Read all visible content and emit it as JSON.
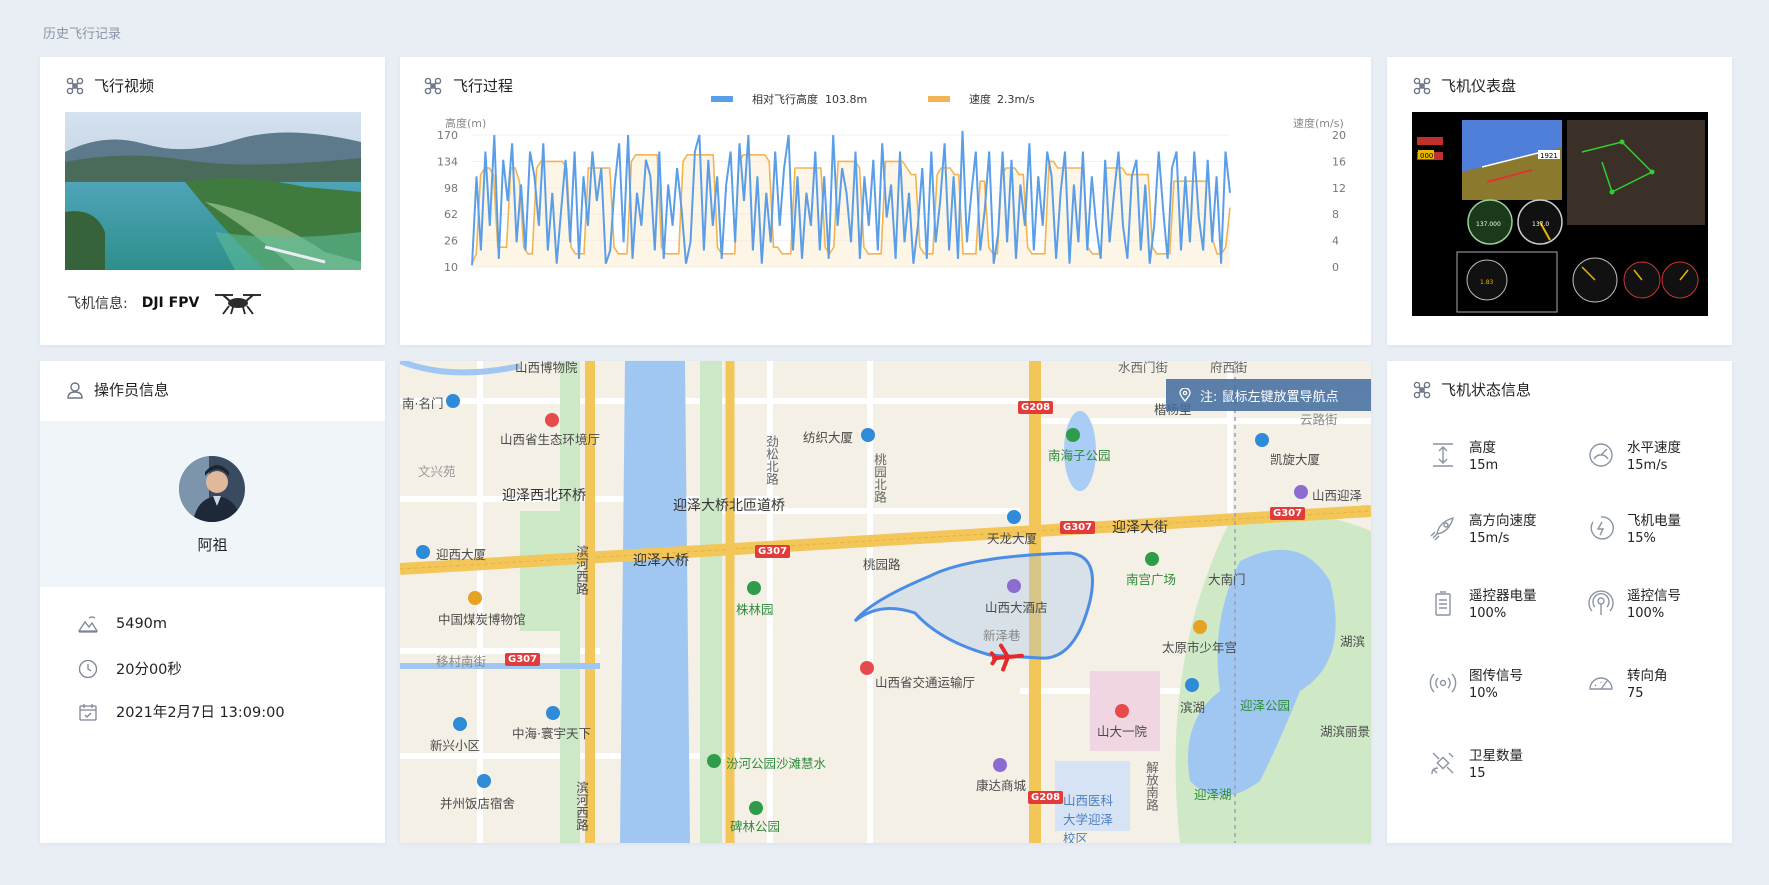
{
  "breadcrumb": "历史飞行记录",
  "video_card": {
    "title": "飞行视频",
    "aircraft_label": "飞机信息:",
    "aircraft_model": "DJI FPV"
  },
  "chart_card": {
    "title": "飞行过程"
  },
  "chart_data": {
    "type": "line",
    "legend_position": "top-center",
    "ylabel_left": "高度(m)",
    "ylabel_right": "速度(m/s)",
    "left_ticks": [
      "170",
      "134",
      "98",
      "62",
      "26",
      "10"
    ],
    "right_ticks": [
      "20",
      "16",
      "12",
      "8",
      "4",
      "0"
    ],
    "ylim_left": [
      10,
      170
    ],
    "ylim_right": [
      0,
      20
    ],
    "grid": true,
    "series": [
      {
        "name": "相对飞行高度",
        "legend_value": "103.8m",
        "color": "#5b9ee8",
        "axis": "left",
        "values": [
          12,
          120,
          30,
          150,
          60,
          170,
          20,
          140,
          90,
          160,
          40,
          110,
          30,
          150,
          120,
          60,
          160,
          30,
          100,
          14,
          80,
          140,
          40,
          150,
          20,
          120,
          60,
          150,
          90,
          130,
          14,
          30,
          110,
          160,
          40,
          170,
          20,
          100,
          60,
          140,
          120,
          30,
          150,
          20,
          110,
          60,
          130,
          80,
          14,
          40,
          150,
          170,
          30,
          140,
          60,
          120,
          20,
          110,
          150,
          40,
          160,
          90,
          170,
          30,
          120,
          14,
          100,
          40,
          150,
          60,
          130,
          170,
          30,
          120,
          20,
          100,
          60,
          150,
          30,
          120,
          20,
          170,
          60,
          130,
          100,
          40,
          150,
          20,
          120,
          60,
          140,
          30,
          160,
          70,
          110,
          20,
          150,
          40,
          100,
          14,
          60,
          130,
          20,
          150,
          40,
          90,
          160,
          30,
          120,
          20,
          175,
          40,
          100,
          150,
          30,
          80,
          150,
          14,
          50,
          150,
          40,
          140,
          20,
          110,
          60,
          160,
          30,
          120,
          60,
          150,
          120,
          20,
          100,
          150,
          14,
          110,
          40,
          150,
          30,
          120,
          60,
          20,
          140,
          40,
          100,
          150,
          60,
          20,
          120,
          140,
          30,
          110,
          14,
          60,
          150,
          80,
          20,
          130,
          150,
          30,
          120,
          40,
          150,
          70,
          30,
          140,
          40,
          120,
          14,
          150,
          100
        ]
      },
      {
        "name": "速度",
        "legend_value": "2.3m/s",
        "color": "#f2b453",
        "axis": "right",
        "values": [
          0.5,
          2,
          14,
          15,
          15,
          14,
          3,
          3,
          3,
          15,
          15,
          13,
          3,
          2,
          2,
          15,
          16,
          16,
          16,
          16,
          16,
          16,
          15,
          3,
          2,
          2,
          2,
          15,
          15,
          15,
          15,
          15,
          15,
          3,
          2,
          2,
          2,
          16,
          17,
          17,
          17,
          17,
          17,
          17,
          3,
          2,
          2,
          2,
          2,
          16,
          17,
          17,
          17,
          17,
          17,
          17,
          17,
          3,
          2,
          2,
          2,
          2,
          16,
          17,
          17,
          17,
          17,
          17,
          17,
          16,
          3,
          3,
          2,
          2,
          2,
          15,
          15,
          15,
          15,
          15,
          15,
          15,
          3,
          2,
          3,
          16,
          16,
          16,
          16,
          16,
          15,
          3,
          2,
          2,
          2,
          2,
          16,
          16,
          16,
          16,
          16,
          15,
          14,
          14,
          3,
          2,
          2,
          2,
          14,
          15,
          15,
          15,
          14,
          14,
          2,
          2,
          2,
          2,
          13,
          13,
          3,
          2,
          2,
          14,
          15,
          15,
          15,
          14,
          14,
          3,
          2,
          2,
          2,
          2,
          16,
          16,
          15,
          15,
          15,
          15,
          15,
          15,
          15,
          3,
          2,
          2,
          2,
          15,
          15,
          15,
          15,
          15,
          14,
          14,
          14,
          14,
          14,
          14,
          3,
          2,
          2,
          2,
          2,
          13,
          13,
          13,
          13,
          13,
          13,
          13,
          13,
          13,
          4,
          2,
          2,
          3,
          9
        ]
      }
    ]
  },
  "dashboard_card": {
    "title": "飞机仪表盘",
    "hud_values": [
      "000",
      "1921",
      "137.000",
      "137.0",
      "1.83"
    ]
  },
  "operator_card": {
    "title": "操作员信息",
    "name": "阿祖",
    "distance": "5490m",
    "duration": "20分00秒",
    "datetime": "2021年2月7日 13:09:00"
  },
  "map": {
    "note": "注: 鼠标左键放置导航点",
    "labels": [
      "山西博物院",
      "山西省生态环境厅",
      "文兴苑",
      "迎泽西北环桥",
      "迎西大厦",
      "中国煤炭博物馆",
      "移村南街",
      "新兴小区",
      "中海·寰宇天下",
      "并州饭店宿舍",
      "滨河西路",
      "迎泽大桥北匝道桥",
      "迎泽大桥",
      "滨河西路",
      "株林园",
      "汾河公园沙滩慧水",
      "碑林公园",
      "纺织大厦",
      "劲松北路",
      "桃园北路",
      "桃园路",
      "天龙大厦",
      "山西大酒店",
      "新泽巷",
      "山西省交通运输厅",
      "康达商城",
      "山西医科大学迎泽校区",
      "山大一院",
      "南海子公园",
      "迎泽大街",
      "南宫广场",
      "太原市少年宫",
      "大南门",
      "凯旋大厦",
      "山西迎泽",
      "湖滨",
      "迎泽公园",
      "滨湖",
      "湖滨丽景",
      "迎泽湖",
      "解放南路",
      "水西门街",
      "府西街",
      "云路街",
      "南·名门",
      "楷杨里"
    ],
    "road_tags": [
      "G208",
      "G307",
      "G307",
      "G307",
      "G307",
      "G208"
    ]
  },
  "status_card": {
    "title": "飞机状态信息",
    "items": [
      {
        "key": "高度",
        "value": "15m",
        "icon": "height-icon"
      },
      {
        "key": "水平速度",
        "value": "15m/s",
        "icon": "speedometer-icon"
      },
      {
        "key": "高方向速度",
        "value": "15m/s",
        "icon": "rocket-icon"
      },
      {
        "key": "飞机电量",
        "value": "15%",
        "icon": "battery-charge-icon"
      },
      {
        "key": "遥控器电量",
        "value": "100%",
        "icon": "remote-battery-icon"
      },
      {
        "key": "遥控信号",
        "value": "100%",
        "icon": "remote-signal-icon"
      },
      {
        "key": "图传信号",
        "value": "10%",
        "icon": "video-signal-icon"
      },
      {
        "key": "转向角",
        "value": "75",
        "icon": "steering-angle-icon"
      },
      {
        "key": "卫星数量",
        "value": "15",
        "icon": "satellite-icon"
      }
    ]
  }
}
